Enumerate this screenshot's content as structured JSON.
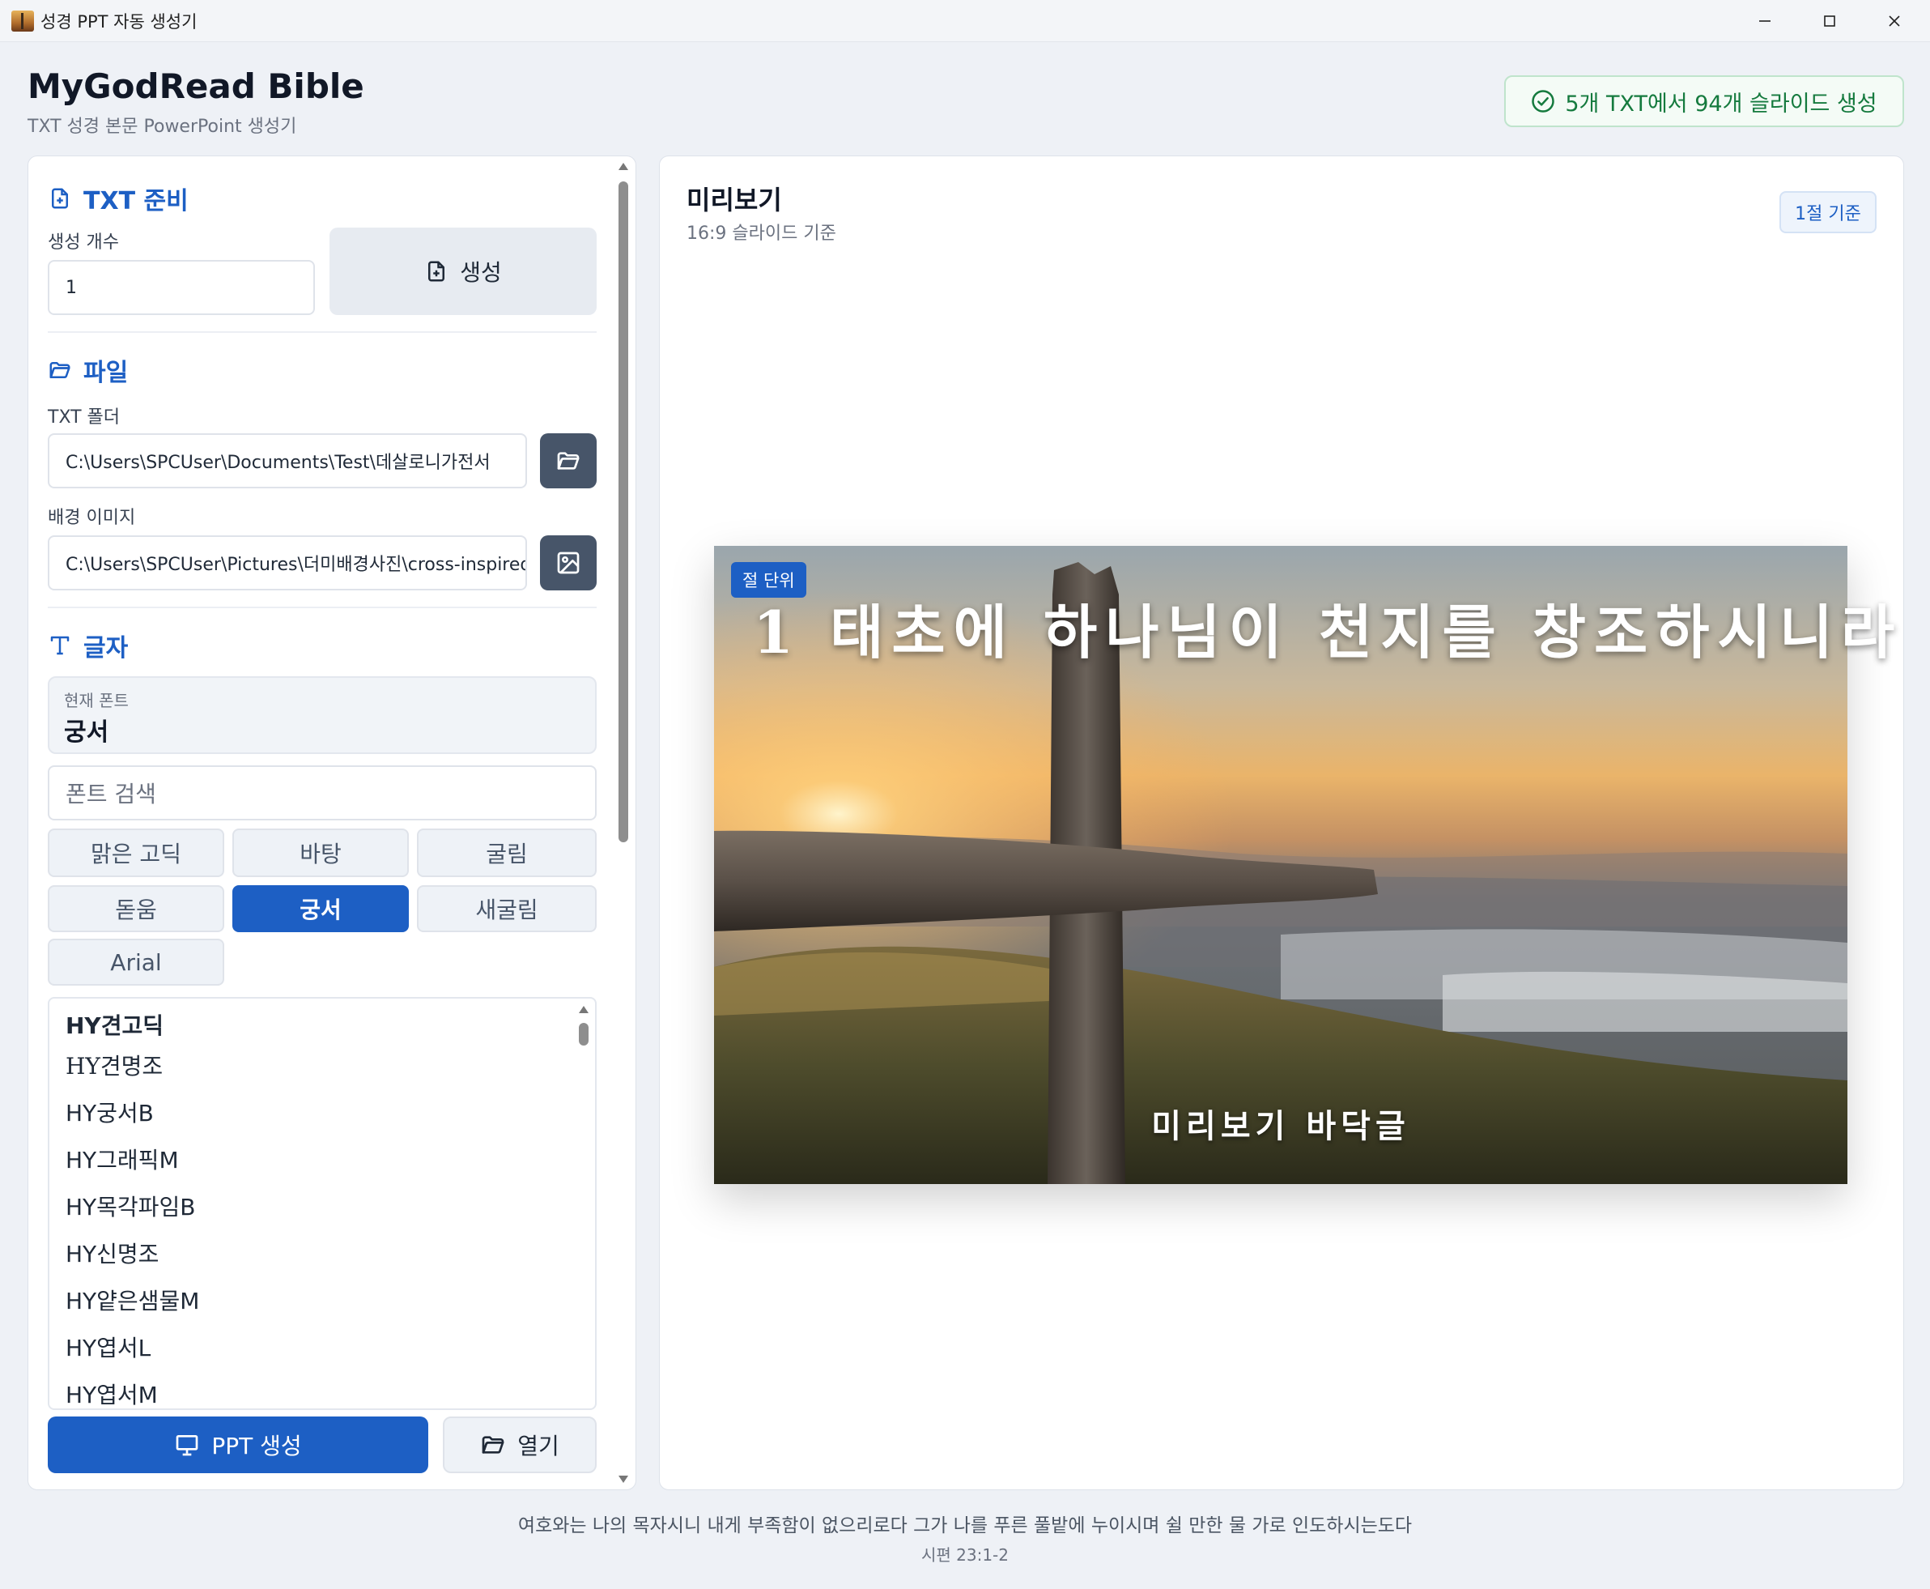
{
  "window": {
    "title": "성경 PPT 자동 생성기",
    "minimize": "—",
    "maximize": "☐",
    "close": "✕"
  },
  "header": {
    "title": "MyGodRead Bible",
    "subtitle": "TXT 성경 본문 PowerPoint 생성기",
    "status": "5개 TXT에서 94개 슬라이드 생성",
    "status_color": "#157a3e"
  },
  "txt_prep": {
    "title": "TXT 준비",
    "count_label": "생성 개수",
    "count_value": "1",
    "generate_label": "생성"
  },
  "file": {
    "title": "파일",
    "txt_folder_label": "TXT 폴더",
    "txt_folder_value": "C:\\Users\\SPCUser\\Documents\\Test\\데살로니가전서",
    "bg_image_label": "배경 이미지",
    "bg_image_value": "C:\\Users\\SPCUser\\Pictures\\더미배경사진\\cross-inspired"
  },
  "text": {
    "title": "글자",
    "current_font_label": "현재 폰트",
    "current_font_value": "궁서",
    "font_search_placeholder": "폰트 검색",
    "quick_fonts": [
      "맑은 고딕",
      "바탕",
      "굴림",
      "돋움",
      "궁서",
      "새굴림",
      "Arial"
    ],
    "active_font": "궁서",
    "font_list": [
      "HY견고딕",
      "HY견명조",
      "HY궁서B",
      "HY그래픽M",
      "HY목각파임B",
      "HY신명조",
      "HY얕은샘물M",
      "HY엽서L",
      "HY엽서M"
    ]
  },
  "actions": {
    "ppt_generate": "PPT 생성",
    "open": "열기"
  },
  "preview": {
    "title": "미리보기",
    "subtitle": "16:9 슬라이드 기준",
    "basis_badge": "1절 기준",
    "slide_badge": "절 단위",
    "slide_verse": "1 태초에 하나님이 천지를 창조하시니라",
    "slide_footer": "미리보기 바닥글"
  },
  "footer": {
    "quote": "여호와는 나의 목자시니 내게 부족함이 없으리로다 그가 나를 푸른 풀밭에 누이시며 쉴 만한 물 가로 인도하시는도다",
    "reference": "시편 23:1-2"
  },
  "colors": {
    "accent": "#1d5fc4",
    "dark_button": "#475569",
    "background": "#eef1f6"
  }
}
